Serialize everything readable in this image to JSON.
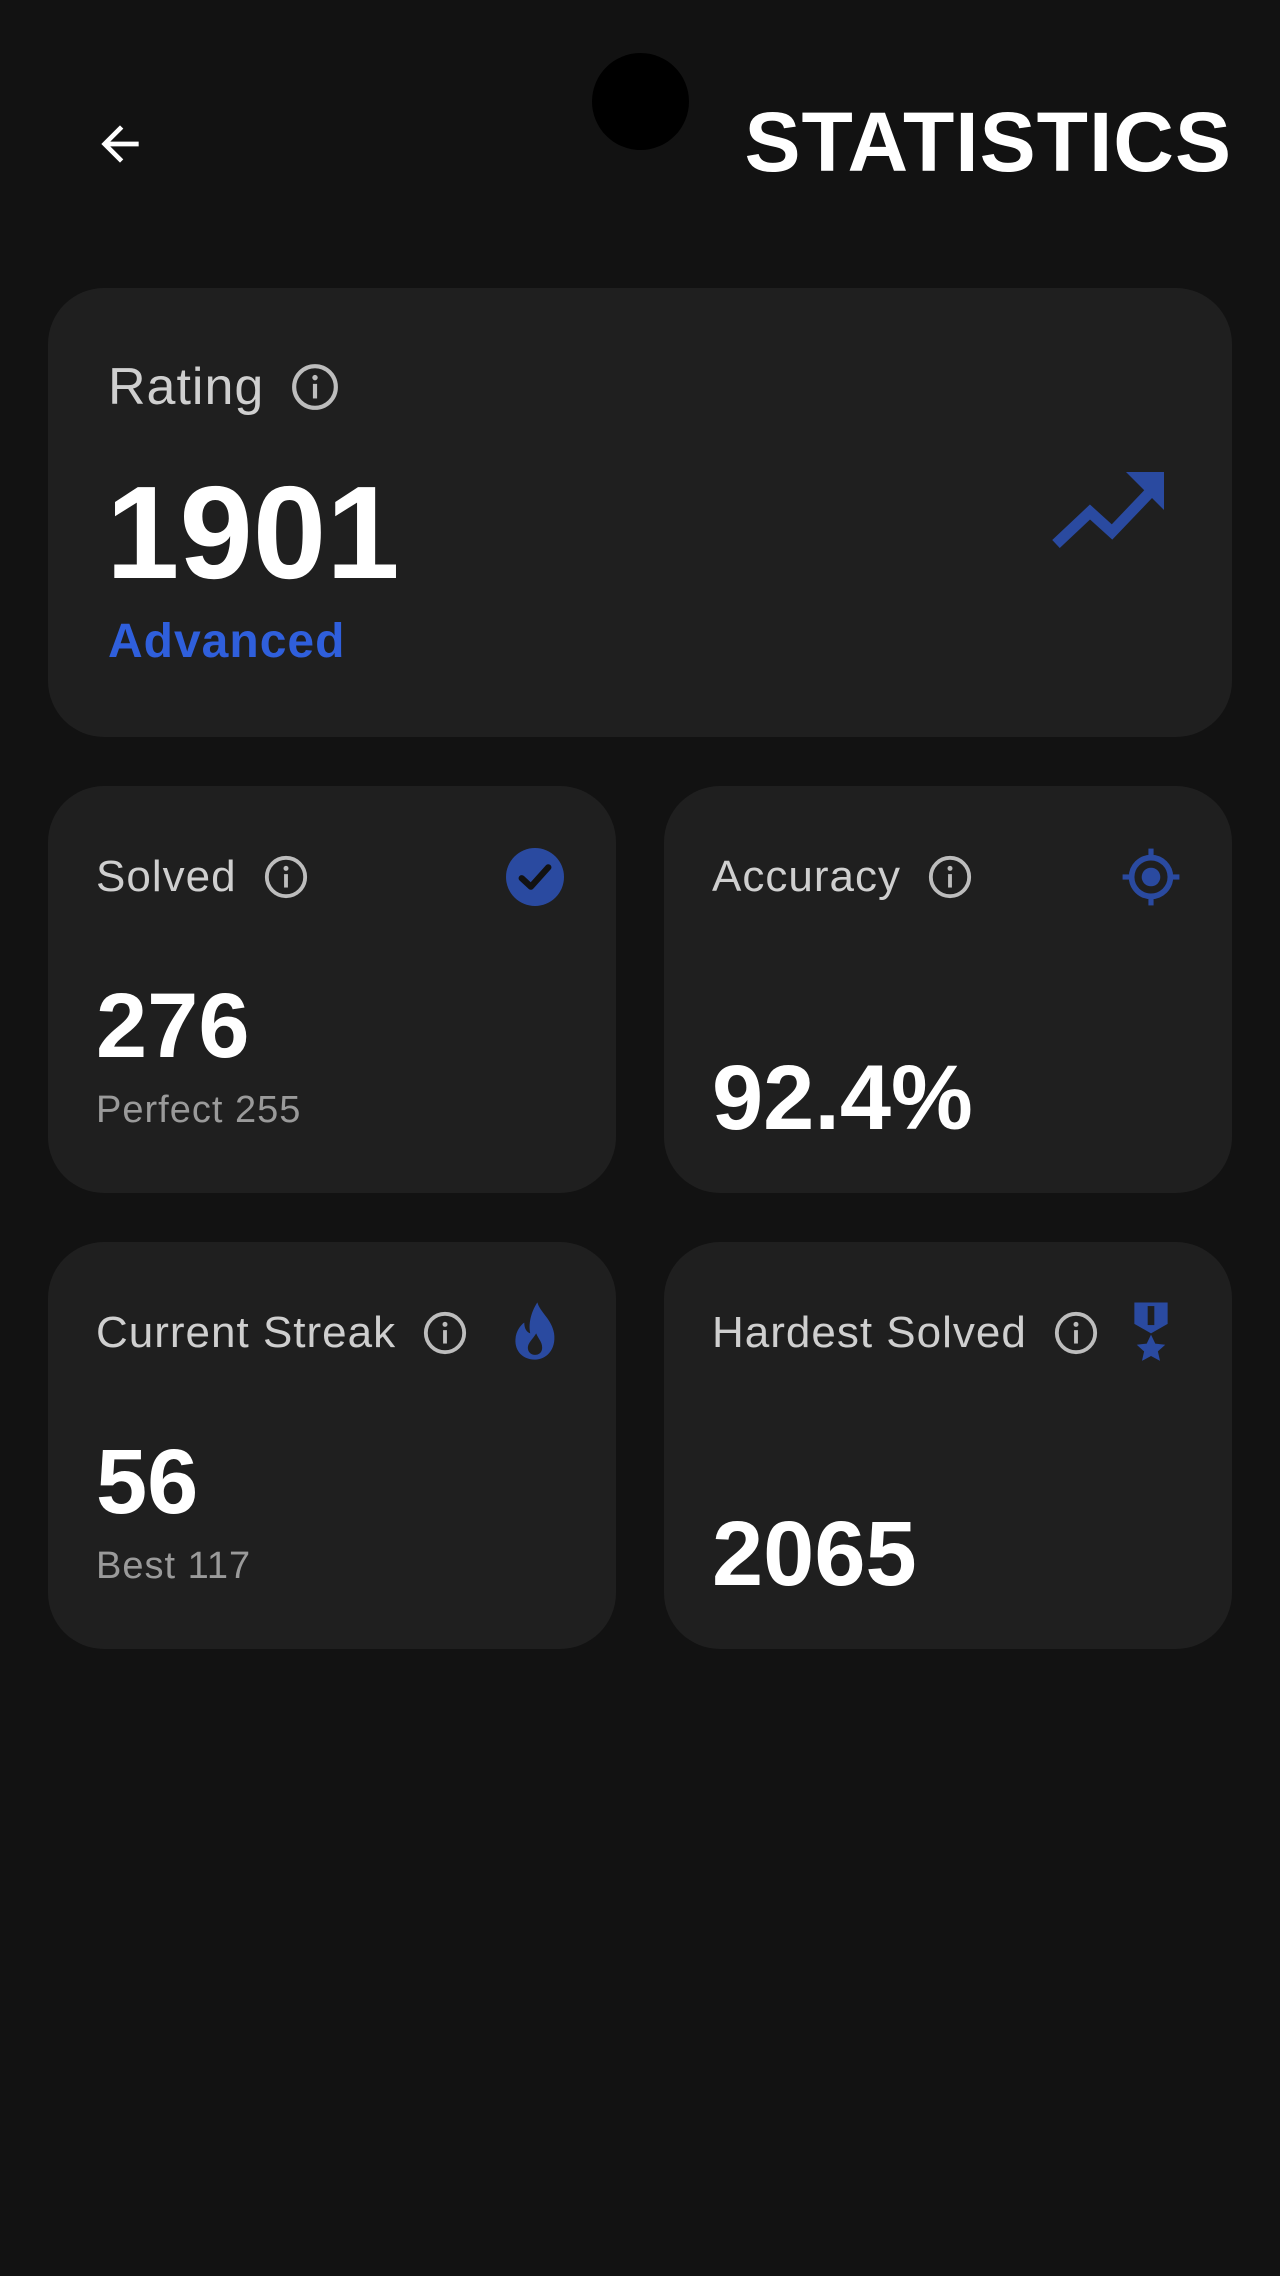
{
  "header": {
    "title": "STATISTICS",
    "back_icon": "arrow-left-icon"
  },
  "colors": {
    "background": "#121212",
    "card": "#1f1f1f",
    "accent": "#2f5fdc",
    "icon_accent": "#2a4aa0",
    "label": "#cfcfcf",
    "subtext": "#9a9a9a"
  },
  "rating": {
    "label": "Rating",
    "value": "1901",
    "level": "Advanced",
    "info_icon": "info-icon",
    "trend_icon": "trending-up-icon"
  },
  "solved": {
    "label": "Solved",
    "value": "276",
    "sub": "Perfect 255",
    "icon": "check-circle-icon"
  },
  "accuracy": {
    "label": "Accuracy",
    "value": "92.4%",
    "icon": "target-icon"
  },
  "streak": {
    "label": "Current Streak",
    "value": "56",
    "sub": "Best 117",
    "icon": "flame-icon"
  },
  "hardest": {
    "label": "Hardest Solved",
    "value": "2065",
    "icon": "medal-icon"
  }
}
